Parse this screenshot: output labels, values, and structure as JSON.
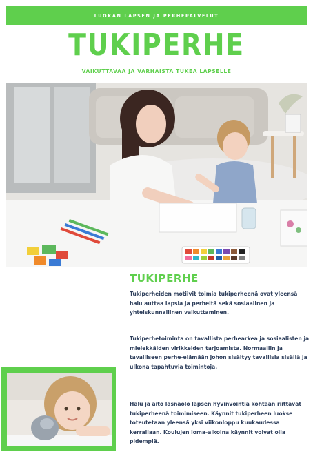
{
  "header": {
    "band_text": "LUOKAN LAPSEN JA PERHEPALVELUT",
    "title": "TUKIPERHE",
    "subtitle": "VAIKUTTAVAA JA VARHAISTA TUKEA LAPSELLE"
  },
  "article": {
    "heading": "TUKIPERHE",
    "paragraphs": [
      "Tukiperheiden motiivit toimia tukiperheenä ovat yleensä halu auttaa lapsia ja perheitä sekä sosiaalinen ja yhteiskunnallinen vaikuttaminen.",
      "Tukiperhetoiminta on tavallista perhearkea ja sosiaalisten ja mielekkäiden virikkeiden tarjoamista. Normaaliin ja tavalliseen perhe-elämään johon sisältyy tavallisia sisällä ja ulkona tapahtuvia toimintoja.",
      "Halu ja aito läsnäolo lapsen hyvinvointia kohtaan riittävät tukiperheenä toimimiseen. Käynnit tukiperheen luokse toteutetaan yleensä yksi viikonloppu kuukaudessa kerrallaan. Koulujen loma-aikoina käynnit voivat olla pidempiä."
    ]
  },
  "colors": {
    "accent": "#5fcf4d",
    "text": "#2e3f5c"
  }
}
